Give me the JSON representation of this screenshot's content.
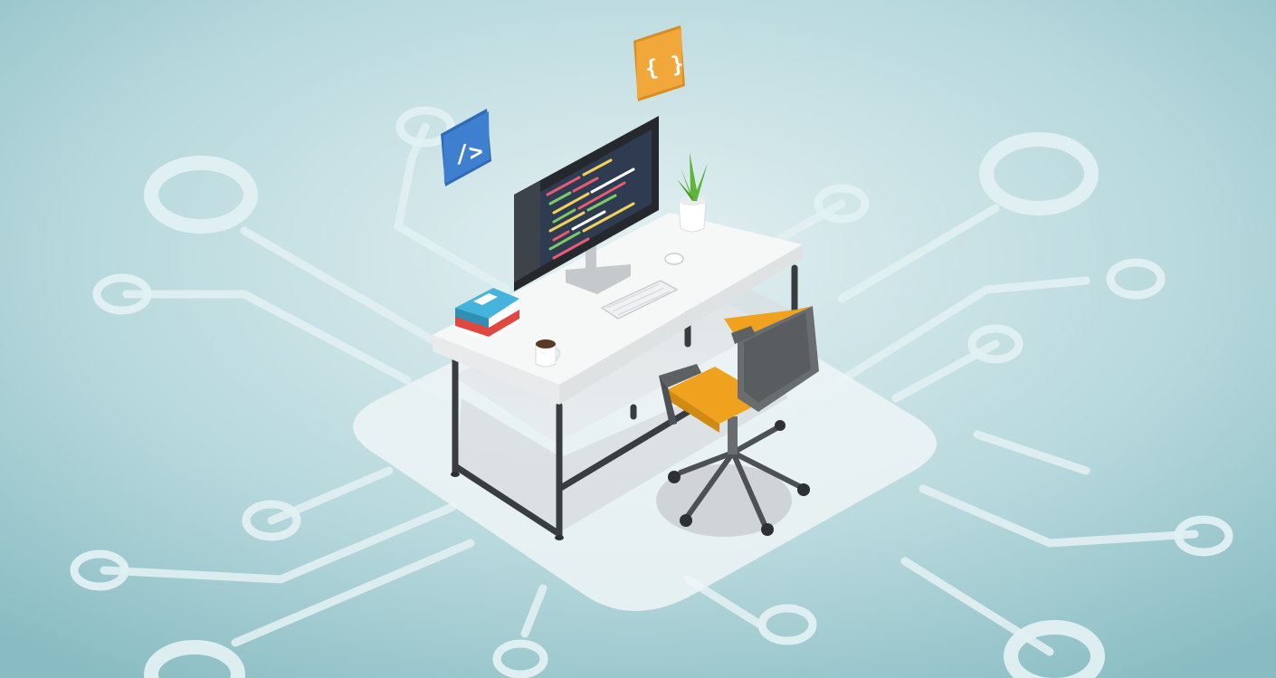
{
  "illustration": {
    "badge_left_symbol": "/>",
    "badge_right_symbol": "{ }"
  },
  "colors": {
    "background_inner": "#dcecef",
    "background_outer": "#8cc0c6",
    "circuit_line": "#e6f2f4",
    "platform": "#eef5f6",
    "desk_top": "#f7f8f8",
    "desk_edge": "#e3e6e7",
    "desk_frame": "#3a3d40",
    "monitor_frame": "#2b2f33",
    "code_screen": "#2e3a4e",
    "badge_blue": "#3f7fd0",
    "badge_orange": "#f2a73b",
    "book_blue": "#45b4dc",
    "book_red": "#e0483f",
    "chair_seat": "#f0a21e",
    "chair_gray": "#6a6d70",
    "plant_green": "#5fb43a"
  },
  "icons": [
    "code-tag-icon",
    "curly-braces-icon"
  ]
}
